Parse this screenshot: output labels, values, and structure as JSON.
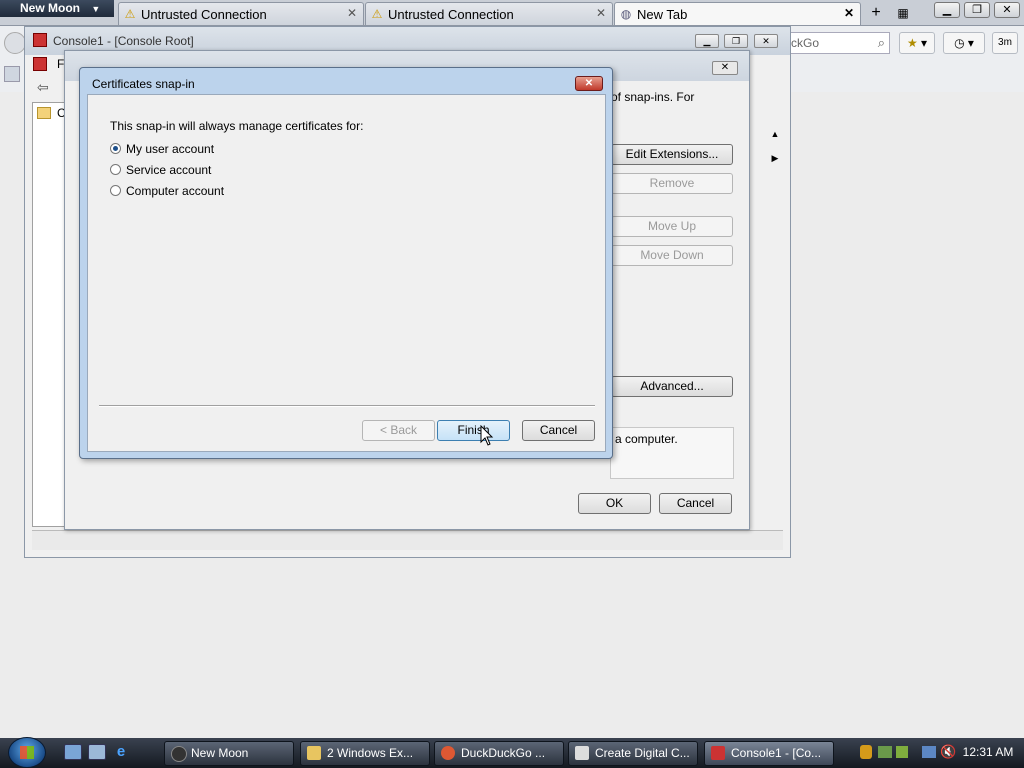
{
  "browser": {
    "app_menu": "New Moon",
    "tabs": [
      {
        "label": "Untrusted Connection"
      },
      {
        "label": "Untrusted Connection"
      },
      {
        "label": "New Tab"
      }
    ],
    "new_tab": "+",
    "search_placeholder": "ckGo",
    "history_badge": "3m"
  },
  "console": {
    "title": "Console1 - [Console Root]",
    "tree_partial": "C",
    "menu_partial": "F"
  },
  "add_remove": {
    "description_partial": "of snap-ins. For",
    "buttons": {
      "edit_extensions": "Edit Extensions...",
      "remove": "Remove",
      "move_up": "Move Up",
      "move_down": "Move Down",
      "advanced": "Advanced...",
      "ok": "OK",
      "cancel": "Cancel"
    },
    "description_box": "a computer."
  },
  "cert_dialog": {
    "title": "Certificates snap-in",
    "prompt": "This snap-in will always manage certificates for:",
    "options": [
      {
        "label": "My user account",
        "checked": true
      },
      {
        "label": "Service account",
        "checked": false
      },
      {
        "label": "Computer account",
        "checked": false
      }
    ],
    "buttons": {
      "back": "< Back",
      "finish": "Finish",
      "cancel": "Cancel"
    }
  },
  "taskbar": {
    "tasks": [
      {
        "label": "New Moon"
      },
      {
        "label": "2 Windows Ex..."
      },
      {
        "label": "DuckDuckGo ..."
      },
      {
        "label": "Create Digital C..."
      },
      {
        "label": "Console1 - [Co..."
      }
    ],
    "clock": "12:31 AM"
  }
}
